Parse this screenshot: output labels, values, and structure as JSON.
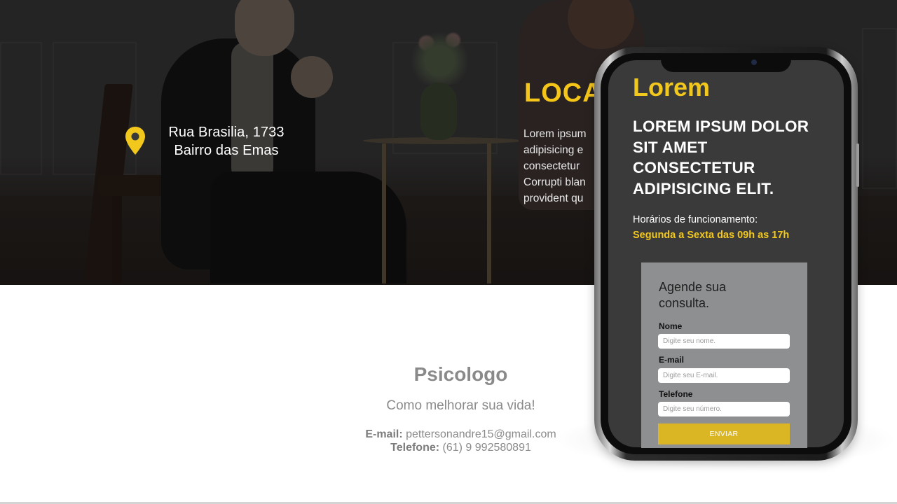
{
  "hero": {
    "address_line1": "Rua Brasilia, 1733",
    "address_line2": "Bairro das Emas",
    "location_title": "LOCA",
    "location_text": [
      "Lorem ipsum",
      "adipisicing e",
      "consectetur",
      "Corrupti blan",
      "provident qu"
    ]
  },
  "footer": {
    "title": "Psicologo",
    "subtitle": "Como melhorar sua vida!",
    "email_label": "E-mail:",
    "email": "pettersonandre15@gmail.com",
    "phone_label": "Telefone:",
    "phone": "(61) 9 992580891"
  },
  "phone_screen": {
    "brand": "Lorem",
    "headline": "LOREM IPSUM DOLOR SIT AMET CONSECTETUR ADIPISICING ELIT.",
    "hours_label": "Horários de funcionamento:",
    "hours_value": "Segunda a Sexta das 09h as 17h",
    "form": {
      "title": "Agende sua consulta.",
      "name_label": "Nome",
      "name_placeholder": "Digite seu nome.",
      "email_label": "E-mail",
      "email_placeholder": "Digite seu E-mail.",
      "phone_label": "Telefone",
      "phone_placeholder": "Digite seu número.",
      "submit_label": "ENVIAR"
    }
  },
  "colors": {
    "accent_yellow": "#f2c81d",
    "button_yellow": "#dab625",
    "form_gray": "#8e8f91",
    "screen_dark": "#3a3a3b",
    "text_gray": "#8a8a8a"
  },
  "icons": {
    "location": "map-pin-icon"
  }
}
